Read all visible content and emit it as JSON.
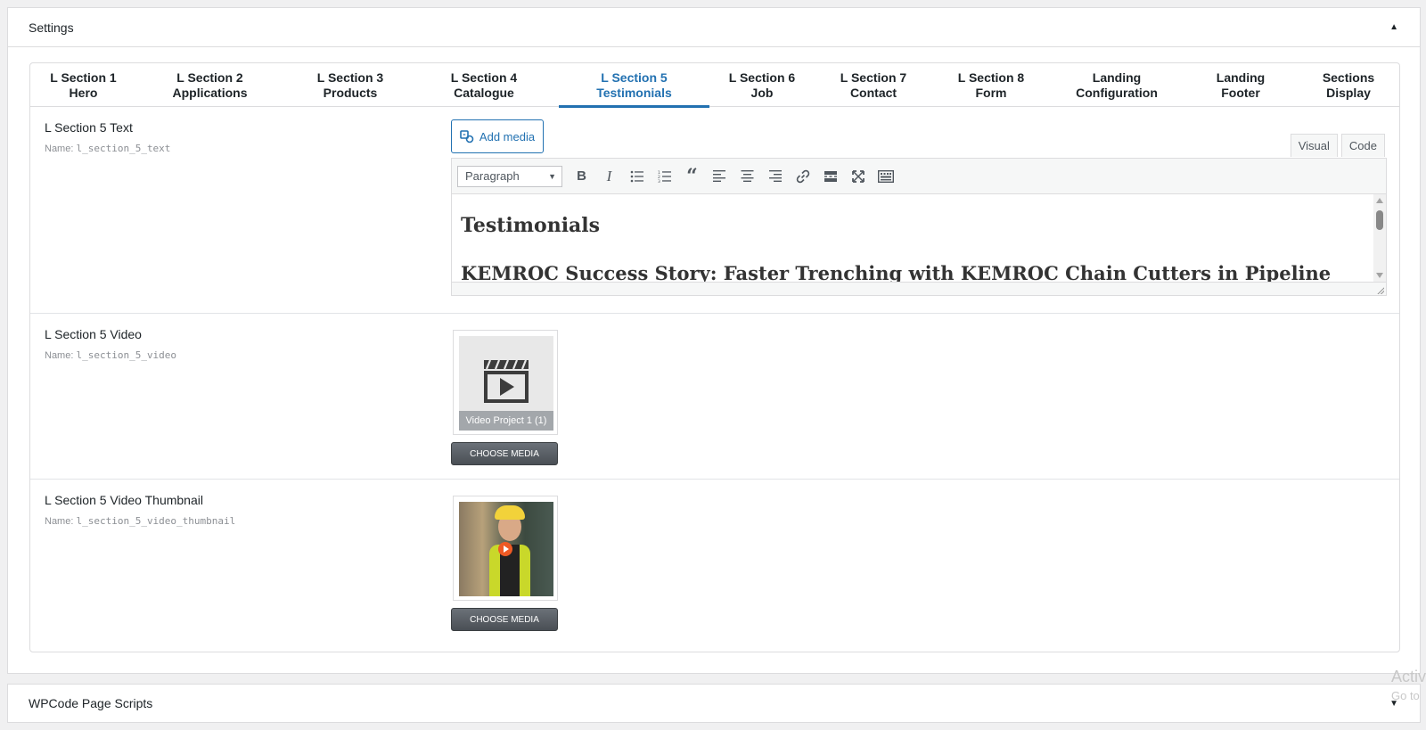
{
  "settings_panel": {
    "title": "Settings",
    "toggle_icon": "collapse-up-icon"
  },
  "tabs": [
    {
      "line1": "L Section 1",
      "line2": "Hero"
    },
    {
      "line1": "L Section 2",
      "line2": "Applications"
    },
    {
      "line1": "L Section 3",
      "line2": "Products"
    },
    {
      "line1": "L Section 4",
      "line2": "Catalogue"
    },
    {
      "line1": "L Section 5",
      "line2": "Testimonials"
    },
    {
      "line1": "L Section 6",
      "line2": "Job"
    },
    {
      "line1": "L Section 7",
      "line2": "Contact"
    },
    {
      "line1": "L Section 8",
      "line2": "Form"
    },
    {
      "line1": "Landing",
      "line2": "Configuration"
    },
    {
      "line1": "Landing",
      "line2": "Footer"
    },
    {
      "line1": "Sections",
      "line2": "Display"
    }
  ],
  "active_tab_index": 4,
  "fields": {
    "text": {
      "label": "L Section 5 Text",
      "name_prefix": "Name: ",
      "name": "l_section_5_text",
      "add_media_label": "Add media",
      "editor_tabs": [
        "Visual",
        "Code"
      ],
      "active_editor_tab": "Visual",
      "format_select": "Paragraph",
      "toolbar_icons": [
        "bold-icon",
        "italic-icon",
        "bullet-list-icon",
        "numbered-list-icon",
        "blockquote-icon",
        "align-left-icon",
        "align-center-icon",
        "align-right-icon",
        "link-icon",
        "read-more-icon",
        "fullscreen-icon",
        "toolbar-toggle-icon"
      ],
      "content_heading": "Testimonials",
      "content_subheading": "KEMROC Success Story: Faster Trenching with KEMROC Chain Cutters in Pipeline"
    },
    "video": {
      "label": "L Section 5 Video",
      "name_prefix": "Name: ",
      "name": "l_section_5_video",
      "media_caption": "Video Project 1 (1)",
      "button_label": "CHOOSE MEDIA"
    },
    "thumbnail": {
      "label": "L Section 5 Video Thumbnail",
      "name_prefix": "Name: ",
      "name": "l_section_5_video_thumbnail",
      "button_label": "CHOOSE MEDIA"
    }
  },
  "wpcode_panel": {
    "title": "WPCode Page Scripts",
    "toggle_icon": "expand-down-icon"
  },
  "watermark": {
    "line1": "Activ",
    "line2": "Go to"
  },
  "colors": {
    "accent": "#2271b1",
    "border": "#dcdcde",
    "button_dark": "#50575e"
  }
}
